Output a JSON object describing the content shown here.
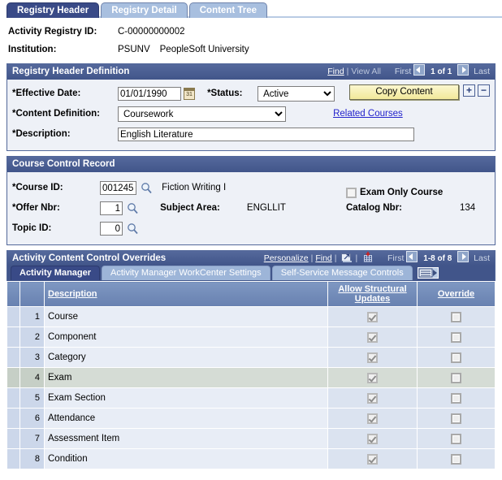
{
  "tabs": [
    {
      "label": "Registry Header",
      "active": true
    },
    {
      "label": "Registry Detail",
      "active": false
    },
    {
      "label": "Content Tree",
      "active": false
    }
  ],
  "page_header": {
    "registry_id_label": "Activity Registry ID:",
    "registry_id_value": "C-00000000002",
    "institution_label": "Institution:",
    "institution_code": "PSUNV",
    "institution_name": "PeopleSoft University"
  },
  "registry_header_definition": {
    "title": "Registry Header Definition",
    "find_label": "Find",
    "view_all_label": "View All",
    "first_label": "First",
    "page_indicator": "1 of 1",
    "last_label": "Last",
    "effective_date_label": "*Effective Date:",
    "effective_date_value": "01/01/1990",
    "status_label": "*Status:",
    "status_value": "Active",
    "status_options": [
      "Active",
      "Inactive"
    ],
    "copy_content_label": "Copy Content",
    "add_row_label": "+",
    "delete_row_label": "−",
    "content_definition_label": "*Content Definition:",
    "content_definition_value": "Coursework",
    "content_definition_options": [
      "Coursework"
    ],
    "related_courses_label": "Related Courses",
    "description_label": "*Description:",
    "description_value": "English Literature"
  },
  "course_control_record": {
    "title": "Course Control Record",
    "course_id_label": "*Course ID:",
    "course_id_value": "001245",
    "course_name": "Fiction Writing I",
    "exam_only_label": "Exam Only Course",
    "exam_only_checked": false,
    "offer_nbr_label": "*Offer Nbr:",
    "offer_nbr_value": "1",
    "subject_area_label": "Subject Area:",
    "subject_area_value": "ENGLLIT",
    "catalog_nbr_label": "Catalog Nbr:",
    "catalog_nbr_value": "134",
    "topic_id_label": "Topic ID:",
    "topic_id_value": "0"
  },
  "activity_content_control_overrides": {
    "title": "Activity Content Control Overrides",
    "personalize_label": "Personalize",
    "find_label": "Find",
    "first_label": "First",
    "page_indicator": "1-8 of 8",
    "last_label": "Last",
    "subtabs": [
      {
        "label": "Activity Manager",
        "active": true
      },
      {
        "label": "Activity Manager WorkCenter Settings",
        "active": false
      },
      {
        "label": "Self-Service Message Controls",
        "active": false
      }
    ],
    "columns": {
      "description": "Description",
      "allow_structural_updates_line1": "Allow Structural",
      "allow_structural_updates_line2": "Updates",
      "override": "Override"
    },
    "rows": [
      {
        "num": "1",
        "description": "Course",
        "allow": true,
        "override": false,
        "highlight": false
      },
      {
        "num": "2",
        "description": "Component",
        "allow": true,
        "override": false,
        "highlight": false
      },
      {
        "num": "3",
        "description": "Category",
        "allow": true,
        "override": false,
        "highlight": false
      },
      {
        "num": "4",
        "description": "Exam",
        "allow": true,
        "override": false,
        "highlight": true
      },
      {
        "num": "5",
        "description": "Exam Section",
        "allow": true,
        "override": false,
        "highlight": false
      },
      {
        "num": "6",
        "description": "Attendance",
        "allow": true,
        "override": false,
        "highlight": false
      },
      {
        "num": "7",
        "description": "Assessment Item",
        "allow": true,
        "override": false,
        "highlight": false
      },
      {
        "num": "8",
        "description": "Condition",
        "allow": true,
        "override": false,
        "highlight": false
      }
    ]
  },
  "colors": {
    "active_tab": "#394a87",
    "inactive_tab": "#a8bfdf",
    "group_header": "#41558a",
    "grid_header": "#6881b0",
    "button_yellow": "#f2e99a",
    "link_blue": "#2222cc",
    "highlight_row": "#d5dcd5"
  }
}
